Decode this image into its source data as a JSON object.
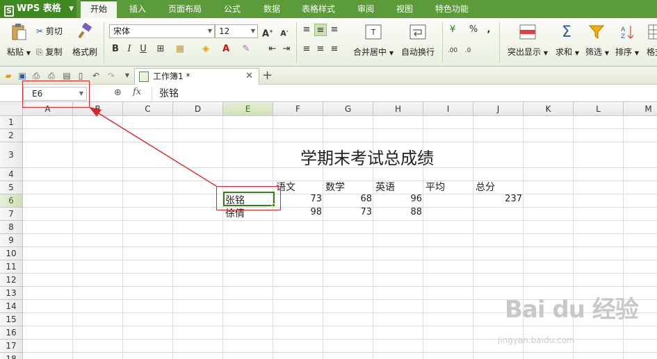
{
  "app": {
    "name": "WPS 表格",
    "logo": "S"
  },
  "menu_tabs": [
    "开始",
    "插入",
    "页面布局",
    "公式",
    "数据",
    "表格样式",
    "审阅",
    "视图",
    "特色功能"
  ],
  "ribbon": {
    "paste": "粘贴",
    "cut": "剪切",
    "copy": "复制",
    "format_painter": "格式刷",
    "font_name": "宋体",
    "font_size": "12",
    "merge_center": "合并居中",
    "wrap_text": "自动换行",
    "highlight": "突出显示",
    "sum": "求和",
    "filter": "筛选",
    "sort": "排序",
    "format": "格式",
    "percent": "%",
    "comma": ","
  },
  "doc_tab": {
    "title": "工作簿1 *"
  },
  "formula_bar": {
    "name_box": "E6",
    "fx": "fx",
    "content": "张铭"
  },
  "columns": [
    "A",
    "B",
    "C",
    "D",
    "E",
    "F",
    "G",
    "H",
    "I",
    "J",
    "K",
    "L",
    "M"
  ],
  "rows": [
    "1",
    "2",
    "3",
    "4",
    "5",
    "6",
    "7",
    "8",
    "9",
    "10",
    "11",
    "12",
    "13",
    "14",
    "15",
    "16",
    "17",
    "18"
  ],
  "selected_cell": {
    "column": "E",
    "row": "6"
  },
  "sheet": {
    "title": "学期末考试总成绩",
    "headers": [
      "语文",
      "数学",
      "英语",
      "平均",
      "总分"
    ],
    "records": [
      {
        "name": "张铭",
        "scores": [
          "73",
          "68",
          "96"
        ],
        "average": "",
        "total": "237"
      },
      {
        "name": "徐倩",
        "scores": [
          "98",
          "73",
          "88"
        ],
        "average": "",
        "total": ""
      }
    ]
  },
  "watermark": {
    "text": "Bai du 经验",
    "sub": "jingyan.baidu.com"
  },
  "colors": {
    "menu_green": "#5b9b3a",
    "selection_green": "#3a7d1f",
    "annotation_red": "#d8262b"
  }
}
